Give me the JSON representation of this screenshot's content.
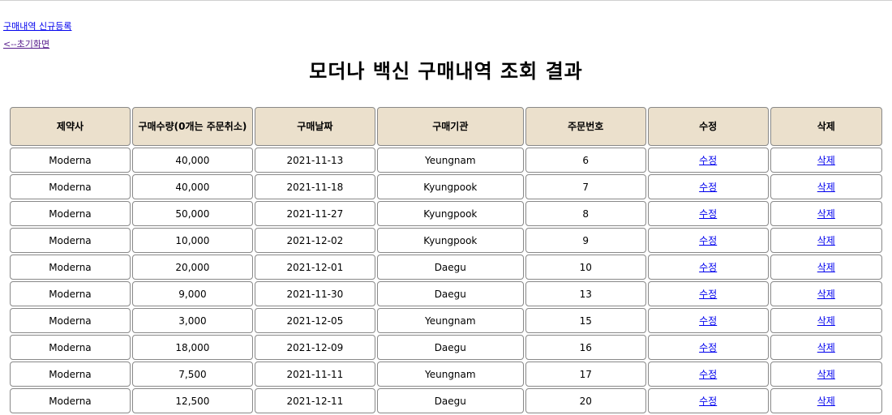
{
  "nav": {
    "new_purchase_label": "구매내역 신규등록",
    "home_label": "<--초기화면"
  },
  "page": {
    "title": "모더나 백신 구매내역 조회 결과"
  },
  "table": {
    "headers": [
      "제약사",
      "구매수량(0개는 주문취소)",
      "구매날짜",
      "구매기관",
      "주문번호",
      "수정",
      "삭제"
    ],
    "rows": [
      {
        "company": "Moderna",
        "quantity": "40,000",
        "date": "2021-11-13",
        "org": "Yeungnam",
        "order_no": "6",
        "edit": "수정",
        "delete": "삭제"
      },
      {
        "company": "Moderna",
        "quantity": "40,000",
        "date": "2021-11-18",
        "org": "Kyungpook",
        "order_no": "7",
        "edit": "수정",
        "delete": "삭제"
      },
      {
        "company": "Moderna",
        "quantity": "50,000",
        "date": "2021-11-27",
        "org": "Kyungpook",
        "order_no": "8",
        "edit": "수정",
        "delete": "삭제"
      },
      {
        "company": "Moderna",
        "quantity": "10,000",
        "date": "2021-12-02",
        "org": "Kyungpook",
        "order_no": "9",
        "edit": "수정",
        "delete": "삭제"
      },
      {
        "company": "Moderna",
        "quantity": "20,000",
        "date": "2021-12-01",
        "org": "Daegu",
        "order_no": "10",
        "edit": "수정",
        "delete": "삭제"
      },
      {
        "company": "Moderna",
        "quantity": "9,000",
        "date": "2021-11-30",
        "org": "Daegu",
        "order_no": "13",
        "edit": "수정",
        "delete": "삭제"
      },
      {
        "company": "Moderna",
        "quantity": "3,000",
        "date": "2021-12-05",
        "org": "Yeungnam",
        "order_no": "15",
        "edit": "수정",
        "delete": "삭제"
      },
      {
        "company": "Moderna",
        "quantity": "18,000",
        "date": "2021-12-09",
        "org": "Daegu",
        "order_no": "16",
        "edit": "수정",
        "delete": "삭제"
      },
      {
        "company": "Moderna",
        "quantity": "7,500",
        "date": "2021-11-11",
        "org": "Yeungnam",
        "order_no": "17",
        "edit": "수정",
        "delete": "삭제"
      },
      {
        "company": "Moderna",
        "quantity": "12,500",
        "date": "2021-12-11",
        "org": "Daegu",
        "order_no": "20",
        "edit": "수정",
        "delete": "삭제"
      }
    ]
  },
  "colors": {
    "header_bg": "#ebe0cc",
    "link": "#0000ee",
    "visited_link": "#551a8b"
  }
}
